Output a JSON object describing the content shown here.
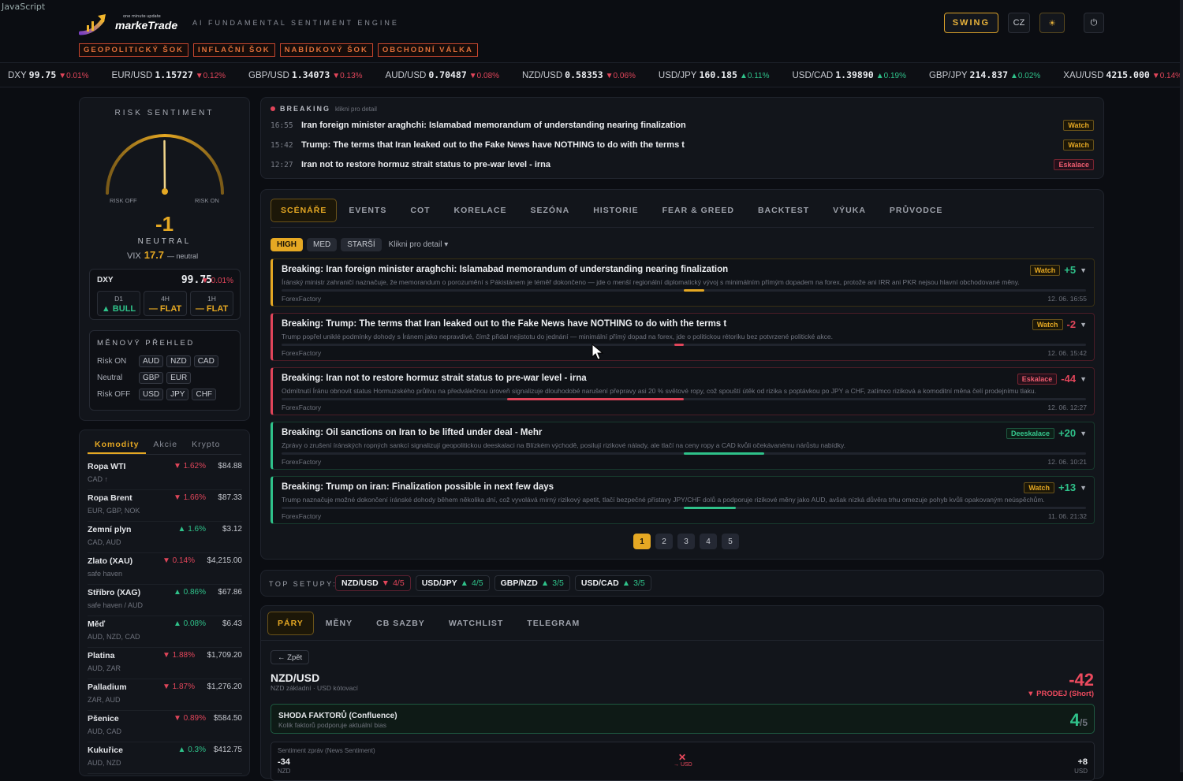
{
  "debug_text": "JavaScript",
  "header": {
    "logo_small": "one minute update",
    "logo_text": "markeTrade",
    "tagline": "AI FUNDAMENTAL SENTIMENT ENGINE",
    "shocks": [
      "GEOPOLITICKÝ ŠOK",
      "INFLAČNÍ ŠOK",
      "NABÍDKOVÝ ŠOK",
      "OBCHODNÍ VÁLKA"
    ],
    "mode": "SWING",
    "lang": "CZ",
    "theme_icon": "☀",
    "power_icon": "⏻"
  },
  "ticker": [
    {
      "sym": "DXY",
      "px": "99.75",
      "ch": "▼0.01%",
      "dir": "down"
    },
    {
      "sym": "EUR/USD",
      "px": "1.15727",
      "ch": "▼0.12%",
      "dir": "down"
    },
    {
      "sym": "GBP/USD",
      "px": "1.34073",
      "ch": "▼0.13%",
      "dir": "down"
    },
    {
      "sym": "AUD/USD",
      "px": "0.70487",
      "ch": "▼0.08%",
      "dir": "down"
    },
    {
      "sym": "NZD/USD",
      "px": "0.58353",
      "ch": "▼0.06%",
      "dir": "down"
    },
    {
      "sym": "USD/JPY",
      "px": "160.185",
      "ch": "▲0.11%",
      "dir": "up"
    },
    {
      "sym": "USD/CAD",
      "px": "1.39890",
      "ch": "▲0.19%",
      "dir": "up"
    },
    {
      "sym": "GBP/JPY",
      "px": "214.837",
      "ch": "▲0.02%",
      "dir": "up"
    },
    {
      "sym": "XAU/USD",
      "px": "4215.000",
      "ch": "▼0.14%",
      "dir": "down"
    }
  ],
  "risk": {
    "title": "RISK SENTIMENT",
    "off_label": "RISK OFF",
    "on_label": "RISK ON",
    "value": "-1",
    "state": "NEUTRAL",
    "vix_label": "VIX",
    "vix_value": "17.7",
    "vix_note": "— neutral",
    "dxy": {
      "label": "DXY",
      "price": "99.75",
      "change": "▼ 0.01%"
    },
    "timeframes": [
      {
        "tf": "D1",
        "val": "▲ BULL",
        "dir": "up"
      },
      {
        "tf": "4H",
        "val": "— FLAT",
        "dir": "flat"
      },
      {
        "tf": "1H",
        "val": "— FLAT",
        "dir": "flat"
      }
    ],
    "currency_title": "MĚNOVÝ PŘEHLED",
    "currency_rows": [
      {
        "label": "Risk ON",
        "codes": [
          "AUD",
          "NZD",
          "CAD"
        ]
      },
      {
        "label": "Neutral",
        "codes": [
          "GBP",
          "EUR"
        ]
      },
      {
        "label": "Risk OFF",
        "codes": [
          "USD",
          "JPY",
          "CHF"
        ]
      }
    ]
  },
  "commodities": {
    "tabs": [
      "Komodity",
      "Akcie",
      "Krypto"
    ],
    "items": [
      {
        "name": "Ropa WTI",
        "sub": "CAD ↑",
        "change": "▼ 1.62%",
        "price": "$84.88",
        "dir": "down"
      },
      {
        "name": "Ropa Brent",
        "sub": "EUR, GBP, NOK",
        "change": "▼ 1.66%",
        "price": "$87.33",
        "dir": "down"
      },
      {
        "name": "Zemní plyn",
        "sub": "CAD, AUD",
        "change": "▲ 1.6%",
        "price": "$3.12",
        "dir": "up"
      },
      {
        "name": "Zlato (XAU)",
        "sub": "safe haven",
        "change": "▼ 0.14%",
        "price": "$4,215.00",
        "dir": "down"
      },
      {
        "name": "Stříbro (XAG)",
        "sub": "safe haven / AUD",
        "change": "▲ 0.86%",
        "price": "$67.86",
        "dir": "up"
      },
      {
        "name": "Měď",
        "sub": "AUD, NZD, CAD",
        "change": "▲ 0.08%",
        "price": "$6.43",
        "dir": "up"
      },
      {
        "name": "Platina",
        "sub": "AUD, ZAR",
        "change": "▼ 1.88%",
        "price": "$1,709.20",
        "dir": "down"
      },
      {
        "name": "Palladium",
        "sub": "ZAR, AUD",
        "change": "▼ 1.87%",
        "price": "$1,276.20",
        "dir": "down"
      },
      {
        "name": "Pšenice",
        "sub": "AUD, CAD",
        "change": "▼ 0.89%",
        "price": "$584.50",
        "dir": "down"
      },
      {
        "name": "Kukuřice",
        "sub": "AUD, NZD",
        "change": "▲ 0.3%",
        "price": "$412.75",
        "dir": "up"
      }
    ]
  },
  "breaking": {
    "title": "BREAKING",
    "hint": "klikni pro detail",
    "items": [
      {
        "time": "16:55",
        "text": "Iran foreign minister araghchi: Islamabad memorandum of understanding nearing finalization",
        "badge": "Watch"
      },
      {
        "time": "15:42",
        "text": "Trump: The terms that Iran leaked out to the Fake News have NOTHING to do with the terms t",
        "badge": "Watch"
      },
      {
        "time": "12:27",
        "text": "Iran not to restore hormuz strait status to pre-war level - irna",
        "badge": "Eskalace"
      }
    ]
  },
  "scenarios": {
    "tabs": [
      "SCÉNÁŘE",
      "EVENTS",
      "COT",
      "KORELACE",
      "SEZÓNA",
      "HISTORIE",
      "FEAR & GREED",
      "BACKTEST",
      "VÝUKA",
      "PRŮVODCE"
    ],
    "filters": [
      "HIGH",
      "MED",
      "STARŠÍ"
    ],
    "filter_hint": "Klikni pro detail ▾",
    "cards": [
      {
        "title": "Breaking: Iran foreign minister araghchi: Islamabad memorandum of understanding nearing finalization",
        "desc": "Íránský ministr zahraničí naznačuje, že memorandum o porozumění s Pákistánem je téměř dokončeno — jde o menší regionální diplomatický vývoj s minimálním přímým dopadem na forex, protože ani IRR ani PKR nejsou hlavní obchodované měny.",
        "source": "ForexFactory",
        "date": "12. 06. 16:55",
        "badge": "Watch",
        "score": "+5",
        "score_value": 5,
        "tone": "watch"
      },
      {
        "title": "Breaking: Trump: The terms that Iran leaked out to the Fake News have NOTHING to do with the terms t",
        "desc": "Trump popřel uniklé podmínky dohody s Íránem jako nepravdivé, čímž přidal nejistotu do jednání — minimální přímý dopad na forex, jde o politickou rétoriku bez potvrzené politické akce.",
        "source": "ForexFactory",
        "date": "12. 06. 15:42",
        "badge": "Watch",
        "score": "-2",
        "score_value": -2,
        "tone": "esk"
      },
      {
        "title": "Breaking: Iran not to restore hormuz strait status to pre-war level - irna",
        "desc": "Odmítnutí Íránu obnovit status Hormuzského průlivu na předválečnou úroveň signalizuje dlouhodobé narušení přepravy asi 20 % světové ropy, což spouští útěk od rizika s poptávkou po JPY a CHF, zatímco riziková a komoditní měna čelí prodejnímu tlaku.",
        "source": "ForexFactory",
        "date": "12. 06. 12:27",
        "badge": "Eskalace",
        "score": "-44",
        "score_value": -44,
        "tone": "esk"
      },
      {
        "title": "Breaking: Oil sanctions on Iran to be lifted under deal - Mehr",
        "desc": "Zprávy o zrušení íránských ropných sankcí signalizují geopolitickou deeskalaci na Blízkém východě, posilují rizikové nálady, ale tlačí na ceny ropy a CAD kvůli očekávanému nárůstu nabídky.",
        "source": "ForexFactory",
        "date": "12. 06. 10:21",
        "badge": "Deeskalace",
        "score": "+20",
        "score_value": 20,
        "tone": "deesk"
      },
      {
        "title": "Breaking: Trump on iran: Finalization possible in next few days",
        "desc": "Trump naznačuje možné dokončení íránské dohody během několika dní, což vyvolává mírný rizikový apetit, tlačí bezpečné přístavy JPY/CHF dolů a podporuje rizikové měny jako AUD, avšak nízká důvěra trhu omezuje pohyb kvůli opakovaným neúspěchům.",
        "source": "ForexFactory",
        "date": "11. 06. 21:32",
        "badge": "Watch",
        "score": "+13",
        "score_value": 13,
        "tone": "deesk"
      }
    ],
    "pages": [
      "1",
      "2",
      "3",
      "4",
      "5"
    ]
  },
  "setups": {
    "label": "TOP SETUPY:",
    "items": [
      {
        "pair": "NZD/USD",
        "arrow": "▼",
        "score": "4/5",
        "dir": "down"
      },
      {
        "pair": "USD/JPY",
        "arrow": "▲",
        "score": "4/5",
        "dir": "up"
      },
      {
        "pair": "GBP/NZD",
        "arrow": "▲",
        "score": "3/5",
        "dir": "up"
      },
      {
        "pair": "USD/CAD",
        "arrow": "▲",
        "score": "3/5",
        "dir": "up"
      }
    ]
  },
  "pairs": {
    "tabs": [
      "PÁRY",
      "MĚNY",
      "CB SAZBY",
      "WATCHLIST",
      "TELEGRAM"
    ],
    "back": "← Zpět",
    "pair": "NZD/USD",
    "sub": "NZD základní · USD kótovací",
    "score": "-42",
    "direction": "▼ PRODEJ (Short)",
    "confluence_title": "SHODA FAKTORŮ (Confluence)",
    "confluence_sub": "Kolik faktorů podporuje aktuální bias",
    "confluence_value": "4",
    "confluence_max": "/5",
    "news_title": "Sentiment zpráv (News Sentiment)",
    "news_left": "-34",
    "news_left_sub": "NZD",
    "news_mid": "✕",
    "news_mid_sub": "→ USD",
    "news_right": "+8",
    "news_right_sub": "USD"
  },
  "colors": {
    "accent": "#e5a823",
    "up": "#2fc28a",
    "down": "#e0455a",
    "shock": "#c7462e",
    "bg": "#0b0d12"
  }
}
